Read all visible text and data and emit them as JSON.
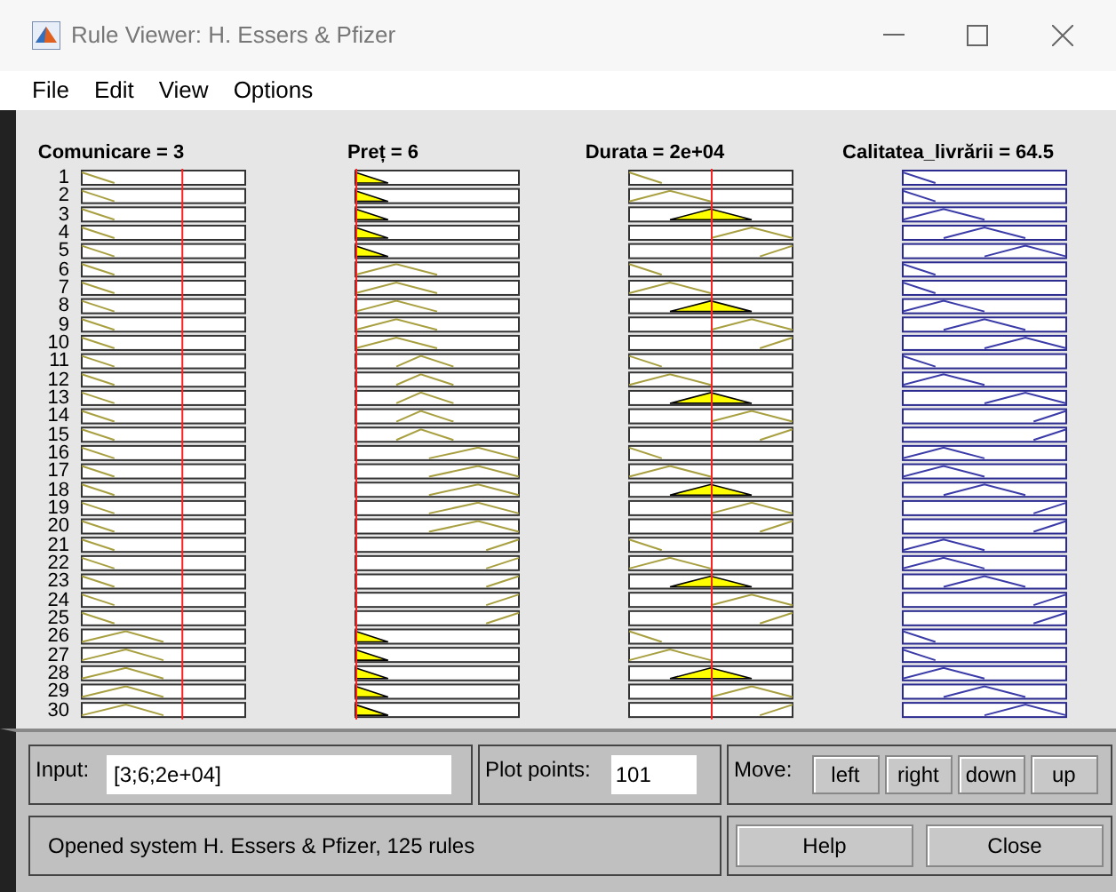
{
  "window": {
    "title": "Rule Viewer: H. Essers & Pfizer"
  },
  "menu": [
    "File",
    "Edit",
    "View",
    "Options"
  ],
  "variables": [
    {
      "label": "Comunicare = 3",
      "kind": "input"
    },
    {
      "label": "Preț = 6",
      "kind": "input"
    },
    {
      "label": "Durata = 2e+04",
      "kind": "input"
    },
    {
      "label": "Calitatea_livrării = 64.5",
      "kind": "output"
    }
  ],
  "rules": [
    "1",
    "2",
    "3",
    "4",
    "5",
    "6",
    "7",
    "8",
    "9",
    "10",
    "11",
    "12",
    "13",
    "14",
    "15",
    "16",
    "17",
    "18",
    "19",
    "20",
    "21",
    "22",
    "23",
    "24",
    "25",
    "26",
    "27",
    "28",
    "29",
    "30"
  ],
  "input": {
    "label": "Input:",
    "value": "[3;6;2e+04]"
  },
  "plot_points": {
    "label": "Plot points:",
    "value": "101"
  },
  "move": {
    "label": "Move:",
    "buttons": [
      "left",
      "right",
      "down",
      "up"
    ]
  },
  "status": "Opened system H. Essers & Pfizer, 125 rules",
  "buttons": [
    "Help",
    "Close"
  ]
}
